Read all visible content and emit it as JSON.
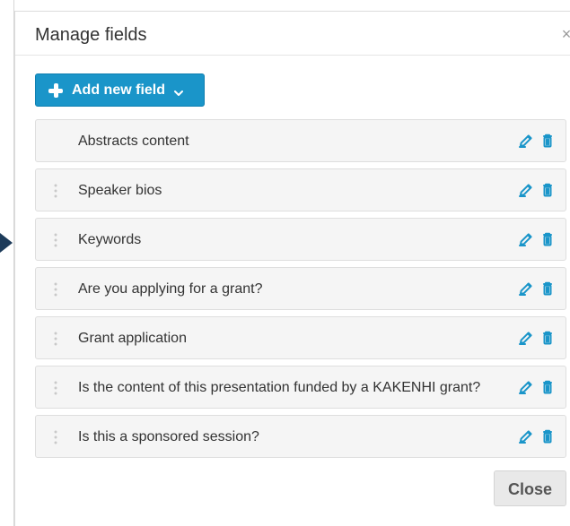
{
  "modal": {
    "title": "Manage fields",
    "close_x_icon": "close-icon",
    "add_button": {
      "label": "Add new field",
      "icon": "plus-icon",
      "caret_icon": "chevron-down-icon",
      "color": "#1A95C9"
    },
    "fields": [
      {
        "label": "Abstracts content",
        "has_drag_handle": false
      },
      {
        "label": "Speaker bios",
        "has_drag_handle": true
      },
      {
        "label": "Keywords",
        "has_drag_handle": true
      },
      {
        "label": "Are you applying for a grant?",
        "has_drag_handle": true
      },
      {
        "label": "Grant application",
        "has_drag_handle": true
      },
      {
        "label": "Is the content of this presentation funded by a KAKENHI grant?",
        "has_drag_handle": true
      },
      {
        "label": "Is this a sponsored session?",
        "has_drag_handle": true
      }
    ],
    "actions": {
      "edit_icon": "edit-icon",
      "delete_icon": "trash-icon",
      "icon_color": "#1A95C9"
    },
    "close_button": {
      "label": "Close"
    }
  }
}
